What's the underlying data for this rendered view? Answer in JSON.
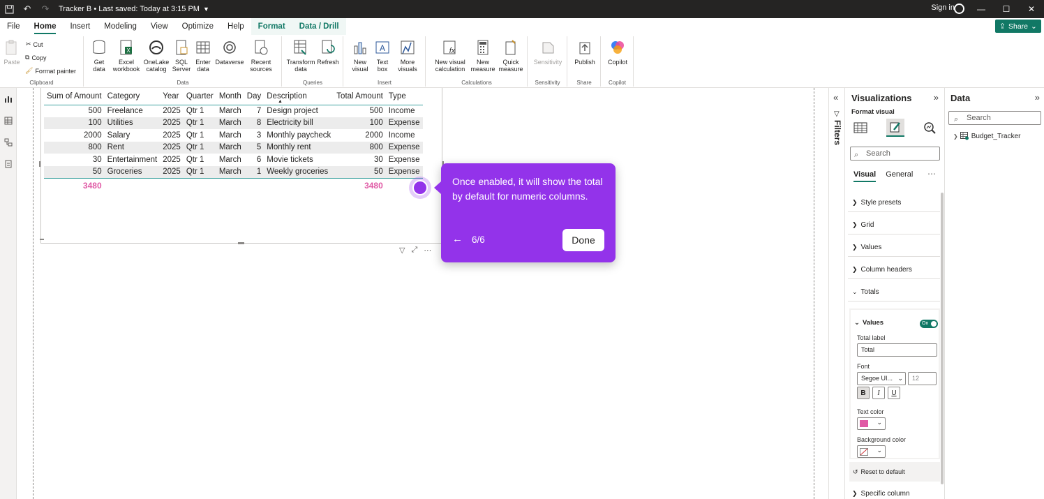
{
  "titlebar": {
    "doc_title": "Tracker B • Last saved: Today at 3:15 PM",
    "signin": "Sign in"
  },
  "menu": {
    "tabs": [
      "File",
      "Home",
      "Insert",
      "Modeling",
      "View",
      "Optimize",
      "Help",
      "Format",
      "Data / Drill"
    ],
    "active": "Home",
    "share": "Share"
  },
  "ribbon": {
    "clipboard": {
      "paste": "Paste",
      "cut": "Cut",
      "copy": "Copy",
      "format_painter": "Format painter",
      "label": "Clipboard"
    },
    "data": {
      "get_data": "Get data",
      "excel": "Excel workbook",
      "onelake": "OneLake catalog",
      "sql": "SQL Server",
      "enter": "Enter data",
      "dataverse": "Dataverse",
      "recent": "Recent sources",
      "label": "Data"
    },
    "queries": {
      "transform": "Transform data",
      "refresh": "Refresh",
      "label": "Queries"
    },
    "insert": {
      "new_visual": "New visual",
      "text_box": "Text box",
      "more_visuals": "More visuals",
      "label": "Insert"
    },
    "calculations": {
      "new_visual_calc": "New visual calculation",
      "new_measure": "New measure",
      "quick_measure": "Quick measure",
      "label": "Calculations"
    },
    "sensitivity": {
      "btn": "Sensitivity",
      "label": "Sensitivity"
    },
    "share": {
      "publish": "Publish",
      "label": "Share"
    },
    "copilot": {
      "btn": "Copilot",
      "label": "Copilot"
    }
  },
  "table": {
    "headers": [
      "Sum of Amount",
      "Category",
      "Year",
      "Quarter",
      "Month",
      "Day",
      "Description",
      "Total Amount",
      "Type"
    ],
    "rows": [
      [
        "500",
        "Freelance",
        "2025",
        "Qtr 1",
        "March",
        "7",
        "Design project",
        "500",
        "Income"
      ],
      [
        "100",
        "Utilities",
        "2025",
        "Qtr 1",
        "March",
        "8",
        "Electricity bill",
        "100",
        "Expense"
      ],
      [
        "2000",
        "Salary",
        "2025",
        "Qtr 1",
        "March",
        "3",
        "Monthly paycheck",
        "2000",
        "Income"
      ],
      [
        "800",
        "Rent",
        "2025",
        "Qtr 1",
        "March",
        "5",
        "Monthly rent",
        "800",
        "Expense"
      ],
      [
        "30",
        "Entertainment",
        "2025",
        "Qtr 1",
        "March",
        "6",
        "Movie tickets",
        "30",
        "Expense"
      ],
      [
        "50",
        "Groceries",
        "2025",
        "Qtr 1",
        "March",
        "1",
        "Weekly groceries",
        "50",
        "Expense"
      ]
    ],
    "totals": {
      "sum_of_amount": "3480",
      "total_amount": "3480"
    },
    "total_color": "#e05aa5"
  },
  "tooltip": {
    "text": "Once enabled, it will show the total by default for numeric columns.",
    "counter": "6/6",
    "done": "Done",
    "color": "#9333ea"
  },
  "filters": {
    "label": "Filters"
  },
  "visualizations": {
    "title": "Visualizations",
    "format_visual": "Format visual",
    "search_placeholder": "Search",
    "tabs": [
      "Visual",
      "General"
    ],
    "sections": [
      "Style presets",
      "Grid",
      "Values",
      "Column headers",
      "Totals"
    ],
    "totals": {
      "values_label": "Values",
      "toggle": "On",
      "total_label_caption": "Total label",
      "total_label_value": "Total",
      "font_caption": "Font",
      "font_family": "Segoe UI...",
      "font_size": "12",
      "bold": "B",
      "italic": "I",
      "underline": "U",
      "text_color_caption": "Text color",
      "text_color": "#e05aa5",
      "background_color_caption": "Background color"
    },
    "reset": "Reset to default",
    "specific_column": "Specific column"
  },
  "data_pane": {
    "title": "Data",
    "search_placeholder": "Search",
    "table_name": "Budget_Tracker"
  }
}
